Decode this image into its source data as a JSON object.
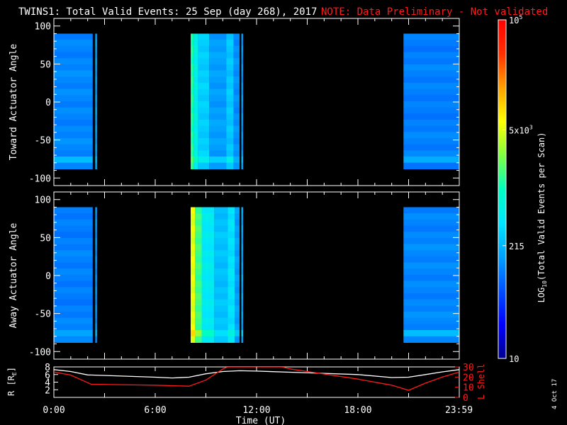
{
  "header": {
    "title": "TWINS1: Total Valid Events: 25 Sep (day 268), 2017",
    "note": "NOTE: Data Preliminary - Not validated"
  },
  "footer": {
    "date_stamp": "4 Oct 17"
  },
  "colors": {
    "background": "#000000",
    "axes": "#ffffff",
    "note": "#ff1a1a",
    "r_line": "#ffffff",
    "lshell_line": "#ff1a1a",
    "colorscale": [
      "#00008b",
      "#0000ff",
      "#0050ff",
      "#00a0ff",
      "#00e5ff",
      "#00ffc0",
      "#80ff40",
      "#ffff00",
      "#ffa000",
      "#ff3000",
      "#ff0000"
    ]
  },
  "chart_data": [
    {
      "type": "heatmap",
      "title": "",
      "xlabel": "",
      "ylabel": "Toward Actuator Angle",
      "xlim_hours": [
        0,
        24
      ],
      "ylim": [
        -110,
        110
      ],
      "yticks": [
        100,
        50,
        0,
        -50,
        -100
      ],
      "ytick_labels": [
        "100",
        "50",
        "0",
        "-50",
        "-100"
      ],
      "data_angle_range": [
        -88,
        90
      ],
      "blocks": [
        {
          "start": 0.0,
          "end": 2.3,
          "level": 0.27
        },
        {
          "start": 2.45,
          "end": 2.55,
          "level": 0.32
        },
        {
          "start": 8.1,
          "end": 8.3,
          "level": 0.52
        },
        {
          "start": 8.3,
          "end": 8.55,
          "level": 0.44
        },
        {
          "start": 8.55,
          "end": 9.2,
          "level": 0.37
        },
        {
          "start": 9.2,
          "end": 10.2,
          "level": 0.3
        },
        {
          "start": 10.2,
          "end": 10.65,
          "level": 0.36
        },
        {
          "start": 10.65,
          "end": 11.0,
          "level": 0.28
        },
        {
          "start": 11.1,
          "end": 11.2,
          "level": 0.3
        },
        {
          "start": 20.7,
          "end": 24.0,
          "level": 0.26
        }
      ]
    },
    {
      "type": "heatmap",
      "title": "",
      "xlabel": "",
      "ylabel": "Away Actuator Angle",
      "xlim_hours": [
        0,
        24
      ],
      "ylim": [
        -110,
        110
      ],
      "yticks": [
        100,
        50,
        0,
        -50,
        -100
      ],
      "ytick_labels": [
        "100",
        "50",
        "0",
        "-50",
        "-100"
      ],
      "data_angle_range": [
        -88,
        90
      ],
      "blocks": [
        {
          "start": 0.0,
          "end": 2.3,
          "level": 0.26
        },
        {
          "start": 2.45,
          "end": 2.55,
          "level": 0.3
        },
        {
          "start": 8.1,
          "end": 8.35,
          "level": 0.68
        },
        {
          "start": 8.35,
          "end": 8.75,
          "level": 0.55
        },
        {
          "start": 8.75,
          "end": 9.5,
          "level": 0.42
        },
        {
          "start": 9.5,
          "end": 10.3,
          "level": 0.35
        },
        {
          "start": 10.3,
          "end": 10.7,
          "level": 0.4
        },
        {
          "start": 10.7,
          "end": 11.0,
          "level": 0.3
        },
        {
          "start": 11.1,
          "end": 11.2,
          "level": 0.32
        },
        {
          "start": 20.7,
          "end": 24.0,
          "level": 0.27
        }
      ]
    },
    {
      "type": "line",
      "title": "",
      "xlabel": "Time (UT)",
      "xticks_hours": [
        0,
        6,
        12,
        18,
        23.98
      ],
      "xtick_labels": [
        "0:00",
        "6:00",
        "12:00",
        "18:00",
        "23:59"
      ],
      "xlim_hours": [
        0,
        24
      ],
      "left_axis": {
        "label_main": "R [R",
        "label_sub": "E",
        "label_end": "]",
        "ylim": [
          0,
          8
        ],
        "ticks": [
          2,
          4,
          6,
          8
        ]
      },
      "right_axis": {
        "label": "L Shell",
        "ylim": [
          0,
          30
        ],
        "ticks": [
          0,
          10,
          20,
          30
        ]
      },
      "series": [
        {
          "axis": "left",
          "x": [
            0,
            1,
            2,
            4,
            6,
            7,
            8,
            9,
            10,
            11,
            12,
            14,
            16,
            18,
            20,
            21,
            22,
            23,
            24
          ],
          "y": [
            7.3,
            6.8,
            5.9,
            5.6,
            5.3,
            5.1,
            5.3,
            6.2,
            6.8,
            7.0,
            6.9,
            6.6,
            6.3,
            6.0,
            5.2,
            5.3,
            6.0,
            6.7,
            7.3
          ]
        },
        {
          "axis": "right",
          "x": [
            0,
            1,
            2.2,
            4,
            6,
            8,
            9,
            10,
            10.3,
            13.5,
            14,
            16,
            18,
            20,
            21,
            22,
            23,
            24
          ],
          "y": [
            25,
            22,
            13,
            12.5,
            12,
            11,
            17,
            28,
            30,
            30,
            28,
            23,
            18,
            12,
            7,
            14,
            20,
            25
          ]
        }
      ]
    },
    {
      "type": "heatmap",
      "title": "",
      "xlabel": "",
      "ylabel": "LOG10(Total Valid Events per Scan)",
      "ylabel_main": "LOG",
      "ylabel_sub": "10",
      "ylabel_rest": "(Total Valid Events per Scan)",
      "scale": "log",
      "range": [
        10,
        100000
      ],
      "ticks": [
        {
          "value": 10,
          "main": "10",
          "exp": ""
        },
        {
          "value": 215,
          "main": "215",
          "exp": ""
        },
        {
          "value": 5000,
          "main": "5x10",
          "exp": "3"
        },
        {
          "value": 100000,
          "main": "10",
          "exp": "5"
        }
      ]
    }
  ]
}
